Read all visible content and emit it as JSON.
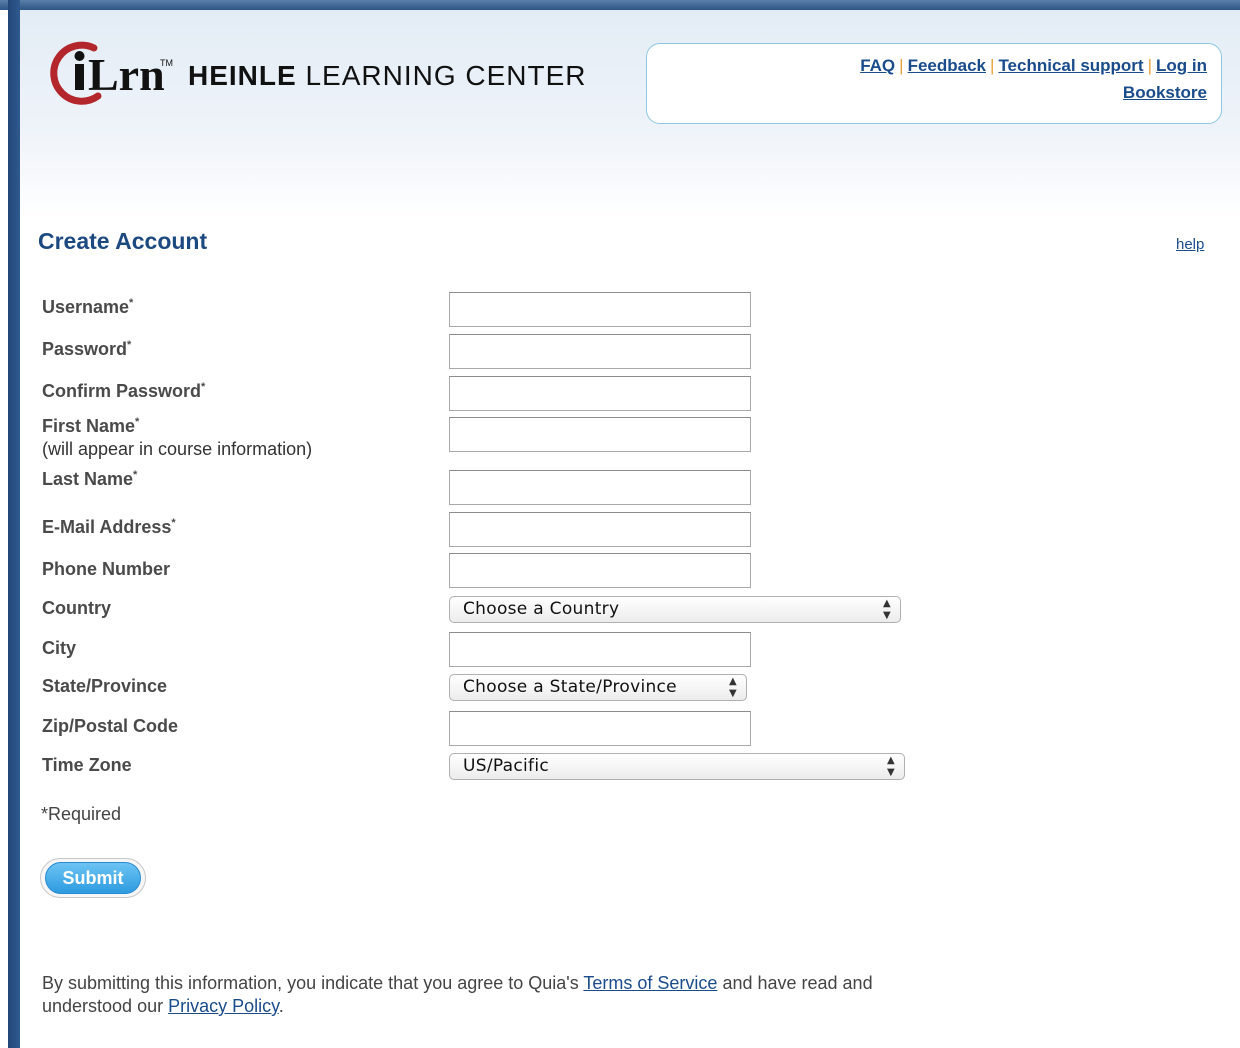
{
  "header": {
    "logo_text": "iLrn",
    "brand_bold": "HEINLE",
    "brand_rest": " LEARNING CENTER"
  },
  "nav": {
    "faq": "FAQ",
    "feedback": "Feedback",
    "support": "Technical support",
    "login": "Log in",
    "bookstore": "Bookstore",
    "separator": "|"
  },
  "page": {
    "title": "Create Account",
    "help": "help"
  },
  "form": {
    "username_label": "Username",
    "password_label": "Password",
    "confirm_label": "Confirm Password",
    "first_name_label": "First Name",
    "first_name_note": "(will appear in course information)",
    "last_name_label": "Last Name",
    "email_label": "E-Mail Address",
    "phone_label": "Phone Number",
    "country_label": "Country",
    "city_label": "City",
    "state_label": "State/Province",
    "zip_label": "Zip/Postal Code",
    "tz_label": "Time Zone",
    "required_marker": "*",
    "country_value": "Choose a Country",
    "state_value": "Choose a State/Province",
    "tz_value": "US/Pacific",
    "required_note": "*Required",
    "submit": "Submit"
  },
  "footer": {
    "agree_prefix": "By submitting this information, you indicate that you agree to Quia's ",
    "terms": "Terms of Service",
    "agree_mid": " and have read and understood our ",
    "privacy": "Privacy Policy",
    "agree_suffix": "."
  },
  "colors": {
    "accent": "#1c4a80",
    "link": "#1a4c8c",
    "logo_red": "#b3262c",
    "submit_blue": "#2d9be0"
  }
}
